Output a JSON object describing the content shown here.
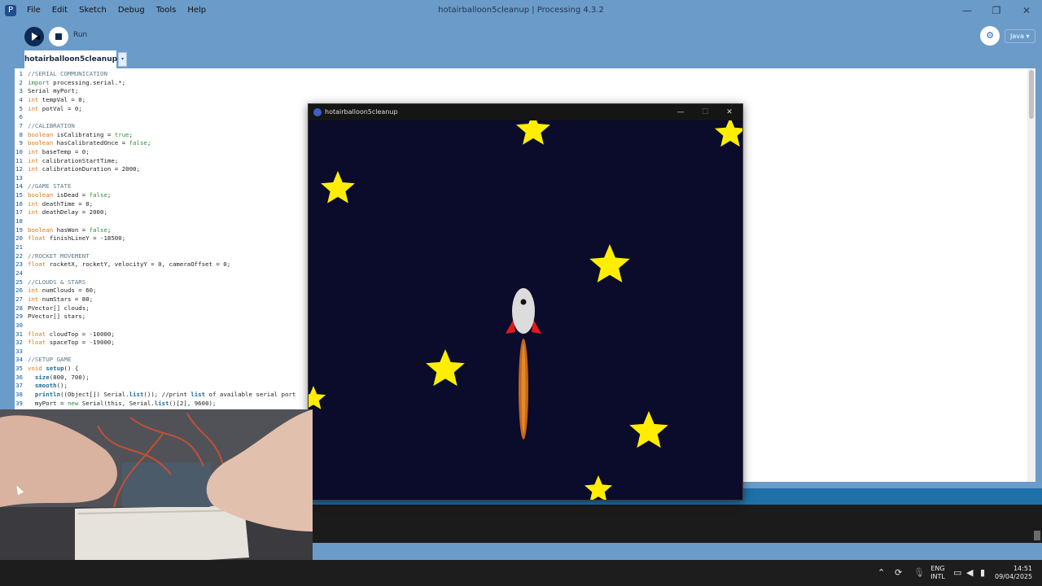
{
  "app": {
    "window_title": "hotairballoon5cleanup | Processing 4.3.2",
    "menu": [
      "File",
      "Edit",
      "Sketch",
      "Debug",
      "Tools",
      "Help"
    ]
  },
  "toolbar": {
    "run_label": "Run",
    "mode": "Java ▾",
    "debugger_icon": "debugger-icon"
  },
  "tabs": {
    "active": "hotairballoon5cleanup",
    "menu_glyph": "▾"
  },
  "editor": {
    "lines": [
      {
        "n": "1",
        "t": "//SERIAL COMMUNICATION"
      },
      {
        "n": "2",
        "t": "import processing.serial.*;"
      },
      {
        "n": "3",
        "t": "Serial myPort;"
      },
      {
        "n": "4",
        "t": "int tempVal = 0;"
      },
      {
        "n": "5",
        "t": "int potVal = 0;"
      },
      {
        "n": "6",
        "t": ""
      },
      {
        "n": "7",
        "t": "//CALIBRATION"
      },
      {
        "n": "8",
        "t": "boolean isCalibrating = true;"
      },
      {
        "n": "9",
        "t": "boolean hasCalibratedOnce = false;"
      },
      {
        "n": "10",
        "t": "int baseTemp = 0;"
      },
      {
        "n": "11",
        "t": "int calibrationStartTime;"
      },
      {
        "n": "12",
        "t": "int calibrationDuration = 2000;"
      },
      {
        "n": "13",
        "t": ""
      },
      {
        "n": "14",
        "t": "//GAME STATE"
      },
      {
        "n": "15",
        "t": "boolean isDead = false;"
      },
      {
        "n": "16",
        "t": "int deathTime = 0;"
      },
      {
        "n": "17",
        "t": "int deathDelay = 2000;"
      },
      {
        "n": "18",
        "t": ""
      },
      {
        "n": "19",
        "t": "boolean hasWon = false;"
      },
      {
        "n": "20",
        "t": "float finishLineY = -18500;"
      },
      {
        "n": "21",
        "t": ""
      },
      {
        "n": "22",
        "t": "//ROCKET MOVEMENT"
      },
      {
        "n": "23",
        "t": "float rocketX, rocketY, velocityY = 0, cameraOffset = 0;"
      },
      {
        "n": "24",
        "t": ""
      },
      {
        "n": "25",
        "t": "//CLOUDS & STARS"
      },
      {
        "n": "26",
        "t": "int numClouds = 60;"
      },
      {
        "n": "27",
        "t": "int numStars = 80;"
      },
      {
        "n": "28",
        "t": "PVector[] clouds;"
      },
      {
        "n": "29",
        "t": "PVector[] stars;"
      },
      {
        "n": "30",
        "t": ""
      },
      {
        "n": "31",
        "t": "float cloudTop = -10000;"
      },
      {
        "n": "32",
        "t": "float spaceTop = -19000;"
      },
      {
        "n": "33",
        "t": ""
      },
      {
        "n": "34",
        "t": "//SETUP GAME"
      },
      {
        "n": "35",
        "t": "void setup() {"
      },
      {
        "n": "36",
        "t": "  size(800, 700);"
      },
      {
        "n": "37",
        "t": "  smooth();"
      },
      {
        "n": "38",
        "t": "  println((Object[]) Serial.list()); //print list of available serial port"
      },
      {
        "n": "39",
        "t": "  myPort = new Serial(this, Serial.list()[2], 9600);"
      }
    ]
  },
  "sketch_window": {
    "title": "hotairballoon5cleanup",
    "colors": {
      "background": "#0b0b2b",
      "star": "#ffee00",
      "rocket_body": "#e0e0e0",
      "fins": "#e01a1a",
      "flame": "#c8641a"
    }
  },
  "taskbar": {
    "lang_top": "ENG",
    "lang_bottom": "INTL",
    "time": "14:51",
    "date": "09/04/2025"
  }
}
